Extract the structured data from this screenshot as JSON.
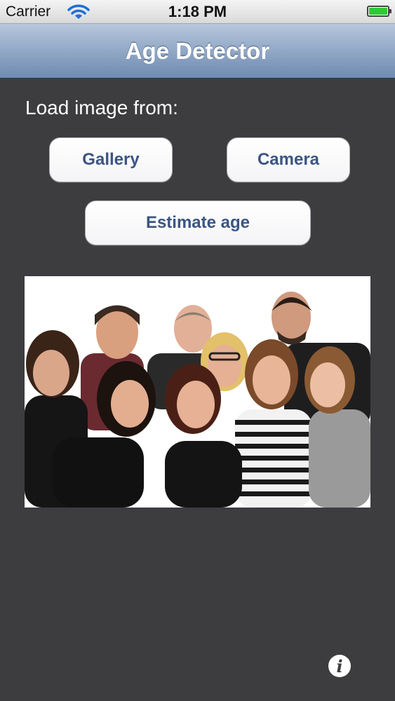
{
  "status_bar": {
    "carrier": "Carrier",
    "time": "1:18 PM",
    "battery_level": 1.0
  },
  "navbar": {
    "title": "Age Detector"
  },
  "main": {
    "load_label": "Load image from:",
    "gallery_button": "Gallery",
    "camera_button": "Camera",
    "estimate_button": "Estimate age"
  },
  "icons": {
    "wifi": "wifi-icon",
    "battery": "battery-icon",
    "info": "info-icon"
  },
  "colors": {
    "accent": "#3b5583",
    "navbar": "#8ea5c4",
    "background": "#3d3d3f"
  }
}
